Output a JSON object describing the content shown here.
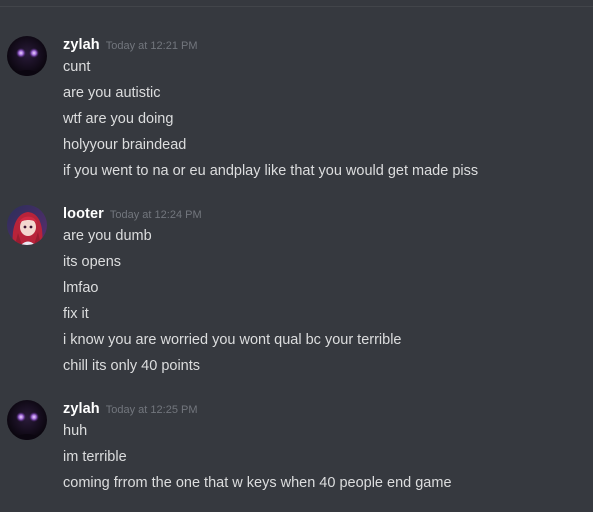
{
  "groups": [
    {
      "username": "zylah",
      "timestamp": "Today at 12:21 PM",
      "avatar_icon": "dark-purple-eyes-avatar",
      "messages": [
        "cunt",
        "are you autistic",
        "wtf are you doing",
        "holyyour braindead",
        "if you went to na or eu andplay like that you would get made piss"
      ]
    },
    {
      "username": "looter",
      "timestamp": "Today at 12:24 PM",
      "avatar_icon": "red-haired-anime-avatar",
      "messages": [
        "are you dumb",
        "its opens",
        "lmfao",
        "fix it",
        "i know you are worried you wont qual  bc your terrible",
        "chill its only 40 points"
      ]
    },
    {
      "username": "zylah",
      "timestamp": "Today at 12:25 PM",
      "avatar_icon": "dark-purple-eyes-avatar",
      "messages": [
        "huh",
        "im terrible",
        "coming frrom the one that w keys when 40 people end game"
      ]
    }
  ],
  "colors": {
    "background": "#36393f",
    "username": "#ffffff",
    "message_text": "#dcddde",
    "timestamp": "#72767d"
  }
}
